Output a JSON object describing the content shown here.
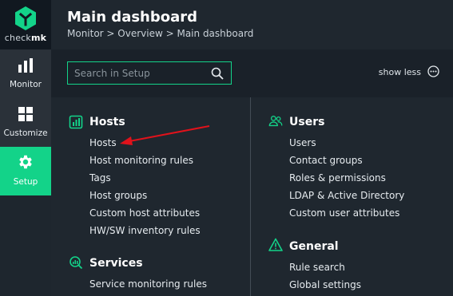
{
  "brand": {
    "logo_prefix": "check",
    "logo_suffix": "mk"
  },
  "sidebar": {
    "items": [
      {
        "label": "Monitor",
        "icon": "bar-chart-icon"
      },
      {
        "label": "Customize",
        "icon": "grid-icon"
      },
      {
        "label": "Setup",
        "icon": "gear-icon",
        "active": true
      }
    ]
  },
  "header": {
    "title": "Main dashboard",
    "breadcrumb": "Monitor > Overview > Main dashboard"
  },
  "search": {
    "placeholder": "Search in Setup",
    "value": ""
  },
  "toolbar": {
    "show_less_label": "show less"
  },
  "sections": {
    "hosts": {
      "title": "Hosts",
      "links": [
        "Hosts",
        "Host monitoring rules",
        "Tags",
        "Host groups",
        "Custom host attributes",
        "HW/SW inventory rules"
      ]
    },
    "services": {
      "title": "Services",
      "links": [
        "Service monitoring rules"
      ]
    },
    "users": {
      "title": "Users",
      "links": [
        "Users",
        "Contact groups",
        "Roles & permissions",
        "LDAP & Active Directory",
        "Custom user attributes"
      ]
    },
    "general": {
      "title": "General",
      "links": [
        "Rule search",
        "Global settings"
      ]
    }
  },
  "colors": {
    "accent": "#13d389",
    "annotation": "#e0121b"
  }
}
